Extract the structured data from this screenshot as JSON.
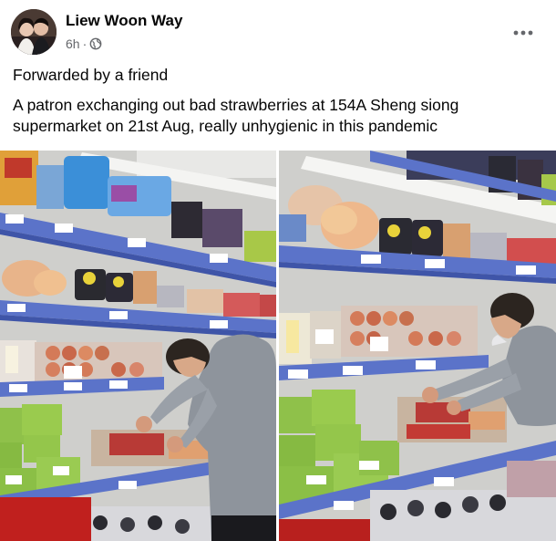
{
  "post": {
    "author": "Liew Woon Way",
    "time": "6h",
    "dot": "·",
    "line1": "Forwarded by a friend",
    "line2": "A patron exchanging out bad strawberries at 154A Sheng siong supermarket on 21st Aug, really unhygienic in this pandemic"
  },
  "icons": {
    "more": "more-options-icon",
    "audience": "globe-icon"
  },
  "colors": {
    "secondary_text": "#65676b",
    "primary_text": "#050505",
    "shelf_blue": "#5b73c9"
  }
}
